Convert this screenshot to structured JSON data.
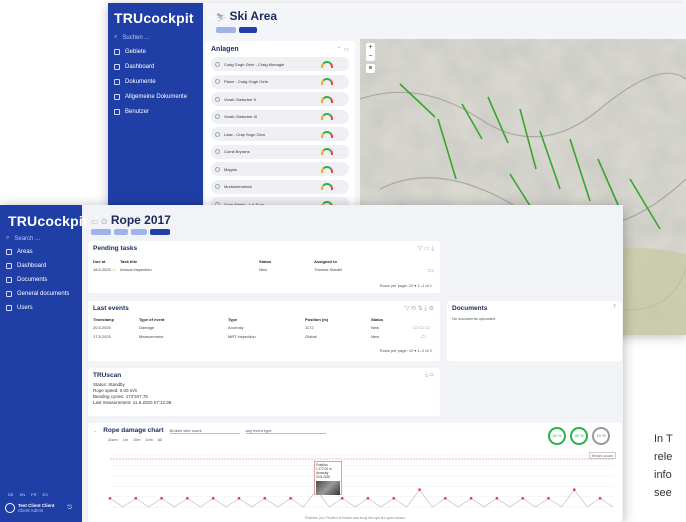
{
  "back_window": {
    "logo": "TRUcockpit",
    "title": "Ski Area",
    "sidebar": [
      {
        "label": "Gebiete",
        "icon": "globe-icon"
      },
      {
        "label": "Dashboard",
        "icon": "grid-icon"
      },
      {
        "label": "Dokumente",
        "icon": "doc-icon"
      },
      {
        "label": "Allgemeine Dokumente",
        "icon": "folder-icon"
      },
      {
        "label": "Benutzer",
        "icon": "user-icon"
      }
    ],
    "search_placeholder": "Suchen ...",
    "anlagen_title": "Anlagen",
    "anlagen": [
      "Craig Gogh Gehr - Craig Monagle",
      "Plaun - Craig Gogh Gehr",
      "Vorab Gletscher II",
      "Vorab Gletscher III",
      "Laax - Crap Sogn Gion",
      "Curnit Bryrans",
      "Magnis",
      "Murtschenstock",
      "Sogn Martin - Lai Sura"
    ]
  },
  "front_window": {
    "logo": "TRUcockpit",
    "title": "Rope 2017",
    "sidebar": [
      {
        "label": "Areas",
        "icon": "globe-icon"
      },
      {
        "label": "Dashboard",
        "icon": "grid-icon"
      },
      {
        "label": "Documents",
        "icon": "doc-icon"
      },
      {
        "label": "General documents",
        "icon": "folder-icon"
      },
      {
        "label": "Users",
        "icon": "user-icon"
      }
    ],
    "search_placeholder": "Search ...",
    "lang": [
      "DE",
      "EN",
      "FR",
      "ES"
    ],
    "user_name": "Test Client Client",
    "user_sub": "Client Admin",
    "pending": {
      "title": "Pending tasks",
      "headers": [
        "Due at",
        "Task title",
        "Status",
        "Assigned to"
      ],
      "rows": [
        [
          "18.6.2020",
          "Annual inspection",
          "New",
          "Thomas Stäubli"
        ]
      ],
      "footer": "Rows per page: 10 ▾   1–1 of 1"
    },
    "events": {
      "title": "Last events",
      "headers": [
        "Timestamp",
        "Type of event",
        "Type",
        "Position (m)",
        "Status"
      ],
      "rows": [
        [
          "20.5.2020",
          "Damage",
          "Anomaly",
          "1172",
          "New"
        ],
        [
          "17.5.2020",
          "Measurement",
          "MRT inspection",
          "Global",
          "New"
        ]
      ],
      "footer": "Rows per page: 10 ▾   1–2 of 2"
    },
    "documents": {
      "title": "Documents",
      "empty": "No documents uploaded"
    },
    "truscan": {
      "title": "TRUscan",
      "lines": [
        "Status: Standby",
        "Rope speed: 0.00 m/s",
        "Bending cycles: 174'347.75",
        "Last measurement: 11.5.2020 07:12:38"
      ]
    },
    "chart": {
      "title": "Rope damage chart",
      "filter1": "Broken wire count",
      "filter2": "any event type",
      "ranges": [
        "Zoom",
        "1m",
        "10m",
        "10m",
        "All"
      ],
      "tooltip": [
        "Position: 1'172.00 m",
        "Anomaly",
        "20.5.2020"
      ],
      "rings": [
        "20 %",
        "40 %",
        "10 %"
      ],
      "button": "Reset zoom",
      "caption": "Positions (m) • Position of broken wire along the rope at a given sensor"
    }
  },
  "chart_data": {
    "type": "line",
    "title": "Rope damage chart",
    "xlabel": "",
    "ylabel": "",
    "ylim": [
      0,
      6
    ],
    "series": [
      {
        "values": [
          1,
          0,
          1,
          0,
          1,
          0,
          1,
          0,
          1,
          0,
          1,
          0,
          1,
          0,
          1,
          0,
          2,
          0,
          1,
          0,
          1,
          0,
          1,
          0,
          2,
          0,
          1,
          0,
          1,
          0,
          1,
          0,
          1,
          0,
          1,
          0,
          2,
          0,
          1,
          0
        ]
      }
    ]
  },
  "side_text": [
    "In T",
    "rele",
    "info",
    "see"
  ]
}
